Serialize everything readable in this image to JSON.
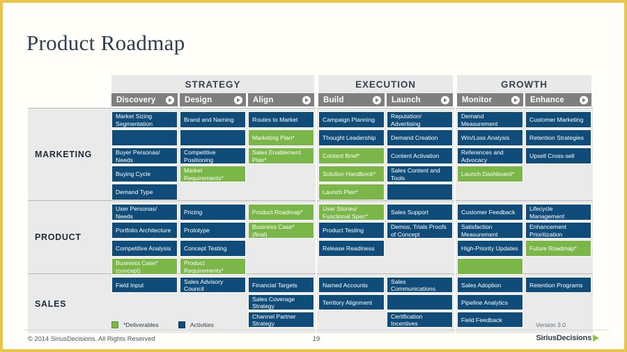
{
  "slide": {
    "title": "Product Roadmap",
    "accent_green": "#7ab648",
    "accent_blue": "#0f4c7a",
    "border_gold": "#e8c44a"
  },
  "groups": [
    {
      "name": "STRATEGY",
      "stages": [
        "Discovery",
        "Design",
        "Align"
      ]
    },
    {
      "name": "EXECUTION",
      "stages": [
        "Build",
        "Launch"
      ]
    },
    {
      "name": "GROWTH",
      "stages": [
        "Monitor",
        "Enhance"
      ]
    }
  ],
  "rows": [
    {
      "label": "MARKETING"
    },
    {
      "label": "PRODUCT"
    },
    {
      "label": "SALES"
    }
  ],
  "cells": {
    "marketing": {
      "discovery": [
        {
          "text": "Market Sizing Segmentation",
          "type": "activity"
        },
        {
          "text": "",
          "type": "activity"
        },
        {
          "text": "Buyer Personas/ Needs",
          "type": "activity"
        },
        {
          "text": "Buying Cycle",
          "type": "activity"
        },
        {
          "text": "Demand Type",
          "type": "activity"
        }
      ],
      "design": [
        {
          "text": "Brand and Naming",
          "type": "activity"
        },
        {
          "text": "",
          "type": "activity"
        },
        {
          "text": "Competitive Positioning",
          "type": "activity"
        },
        {
          "text": "Market Requirements*",
          "type": "deliverable"
        }
      ],
      "align": [
        {
          "text": "Routes to Market",
          "type": "activity"
        },
        {
          "text": "Marketing Plan*",
          "type": "deliverable"
        },
        {
          "text": "Sales Enablement Plan*",
          "type": "deliverable"
        }
      ],
      "build": [
        {
          "text": "Campaign Planning",
          "type": "activity"
        },
        {
          "text": "Thought Leadership",
          "type": "activity"
        },
        {
          "text": "Content Brief*",
          "type": "deliverable"
        },
        {
          "text": "Solution Handbook*",
          "type": "deliverable"
        },
        {
          "text": "Launch Plan*",
          "type": "deliverable"
        }
      ],
      "launch": [
        {
          "text": "Reputation/ Advertising",
          "type": "activity"
        },
        {
          "text": "Demand Creation",
          "type": "activity"
        },
        {
          "text": "Content Activation",
          "type": "activity"
        },
        {
          "text": "Sales Content and Tools",
          "type": "activity"
        },
        {
          "text": "",
          "type": "activity"
        }
      ],
      "monitor": [
        {
          "text": "Demand Measurement",
          "type": "activity"
        },
        {
          "text": "Win/Loss Analysis",
          "type": "activity"
        },
        {
          "text": "References and Advocacy",
          "type": "activity"
        },
        {
          "text": "Launch Dashboard*",
          "type": "deliverable"
        }
      ],
      "enhance": [
        {
          "text": "Customer Marketing",
          "type": "activity"
        },
        {
          "text": "Retention Strategies",
          "type": "activity"
        },
        {
          "text": "Upsell Cross-sell",
          "type": "activity"
        }
      ]
    },
    "product": {
      "discovery": [
        {
          "text": "User Personas/ Needs",
          "type": "activity"
        },
        {
          "text": "Portfolio Architecture",
          "type": "activity"
        },
        {
          "text": "Competitive Analysis",
          "type": "activity"
        },
        {
          "text": "Business Case* (concept)",
          "type": "deliverable"
        }
      ],
      "design": [
        {
          "text": "Pricing",
          "type": "activity"
        },
        {
          "text": "Prototype",
          "type": "activity"
        },
        {
          "text": "Concept Testing",
          "type": "activity"
        },
        {
          "text": "Product Requirements*",
          "type": "deliverable"
        }
      ],
      "align": [
        {
          "text": "Product Roadmap*",
          "type": "deliverable"
        },
        {
          "text": "Business Case* (final)",
          "type": "deliverable"
        }
      ],
      "build": [
        {
          "text": "User Stories/ Functional Spec*",
          "type": "deliverable"
        },
        {
          "text": "Product Testing",
          "type": "activity"
        },
        {
          "text": "Release Readiness",
          "type": "activity"
        }
      ],
      "launch": [
        {
          "text": "Sales Support",
          "type": "activity"
        },
        {
          "text": "Demos, Trials Proofs of Concept",
          "type": "activity"
        }
      ],
      "monitor": [
        {
          "text": "Customer Feedback",
          "type": "activity"
        },
        {
          "text": "Satisfaction Measurement",
          "type": "activity"
        },
        {
          "text": "High-Priority Updates",
          "type": "activity"
        },
        {
          "text": "",
          "type": "deliverable"
        }
      ],
      "enhance": [
        {
          "text": "Lifecycle Management",
          "type": "activity"
        },
        {
          "text": "Enhancement Prioritization",
          "type": "activity"
        },
        {
          "text": "Future Roadmap*",
          "type": "deliverable"
        }
      ]
    },
    "sales": {
      "discovery": [
        {
          "text": "Field Input",
          "type": "activity"
        }
      ],
      "design": [
        {
          "text": "Sales Advisory Council",
          "type": "activity"
        }
      ],
      "align": [
        {
          "text": "Financial Targets",
          "type": "activity"
        },
        {
          "text": "Sales Coverage Strategy",
          "type": "activity"
        },
        {
          "text": "Channel Partner Strategy",
          "type": "activity"
        }
      ],
      "build": [
        {
          "text": "Named Accounts",
          "type": "activity"
        },
        {
          "text": "Territory Alignment",
          "type": "activity"
        }
      ],
      "launch": [
        {
          "text": "Sales Communications",
          "type": "activity"
        },
        {
          "text": "",
          "type": "activity"
        },
        {
          "text": "Certification Incentives",
          "type": "activity"
        }
      ],
      "monitor": [
        {
          "text": "Sales Adoption",
          "type": "activity"
        },
        {
          "text": "Pipeline Analytics",
          "type": "activity"
        },
        {
          "text": "Field Feedback",
          "type": "activity"
        }
      ],
      "enhance": [
        {
          "text": "Retention Programs",
          "type": "activity"
        }
      ]
    }
  },
  "legend": {
    "deliverables_label": "*Deliverables",
    "activities_label": "Activities"
  },
  "version": "Version 3.0",
  "footer": {
    "copyright": "© 2014 SiriusDecisions. All Rights Reserved",
    "page_number": "19",
    "logo_text": "SiriusDecisions"
  }
}
